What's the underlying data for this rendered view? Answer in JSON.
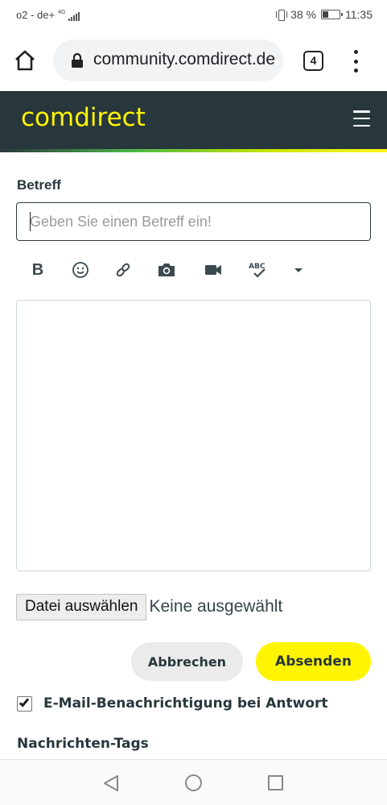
{
  "status_bar": {
    "carrier": "o2 - de+",
    "network": "4G",
    "battery_percent": "38 %",
    "battery_level": 0.38,
    "time": "11:35"
  },
  "browser": {
    "url": "community.comdirect.de",
    "tab_count": "4",
    "icons": [
      "home-icon",
      "lock-icon",
      "tab-switcher-icon",
      "more-vert-icon"
    ]
  },
  "site": {
    "logo_text": "comdirect",
    "brand_yellow": "#fff500",
    "header_color": "#28373c"
  },
  "form": {
    "subject_label": "Betreff",
    "subject_placeholder": "Geben Sie einen Betreff ein!",
    "subject_value": "",
    "toolbar": {
      "bold_label": "B",
      "icons": [
        "bold-icon",
        "emoji-icon",
        "link-icon",
        "camera-icon",
        "video-icon",
        "spellcheck-icon",
        "dropdown-arrow-icon"
      ]
    },
    "file_button_label": "Datei auswählen",
    "file_status": "Keine ausgewählt",
    "cancel_label": "Abbrechen",
    "send_label": "Absenden",
    "notify_label": "E-Mail-Benachrichtigung bei Antwort",
    "notify_checked": true,
    "tags_label": "Nachrichten-Tags"
  },
  "nav_bar": {
    "icons": [
      "back-icon",
      "home-circle-icon",
      "recent-apps-icon"
    ]
  }
}
